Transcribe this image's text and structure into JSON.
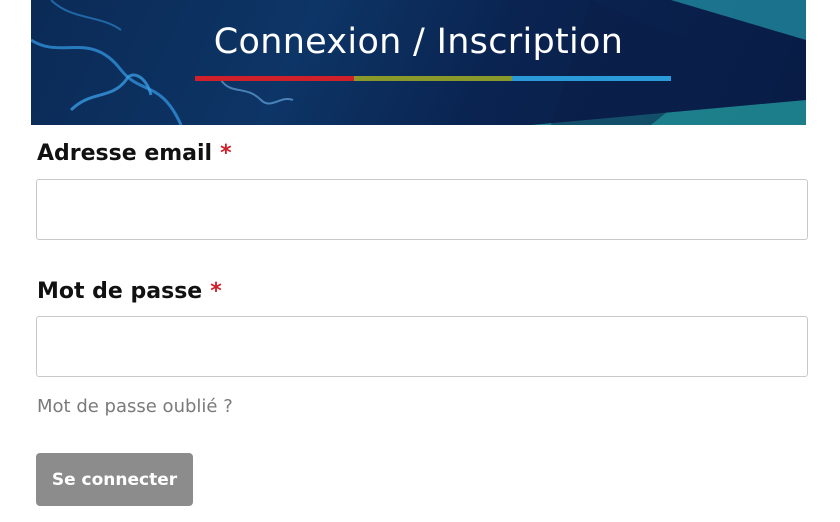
{
  "header": {
    "title": "Connexion / Inscription",
    "underline_colors": [
      "#d0202a",
      "#8a9a2a",
      "#2a9ad8"
    ]
  },
  "form": {
    "email": {
      "label": "Adresse email",
      "required_mark": "*",
      "value": ""
    },
    "password": {
      "label": "Mot de passe",
      "required_mark": "*",
      "value": ""
    },
    "forgot_link": "Mot de passe oublié ?",
    "submit_label": "Se connecter"
  },
  "colors": {
    "banner_bg": "#0b2a56",
    "required": "#d0202a",
    "button_bg": "#8c8c8c",
    "link": "#7a7a7a"
  }
}
